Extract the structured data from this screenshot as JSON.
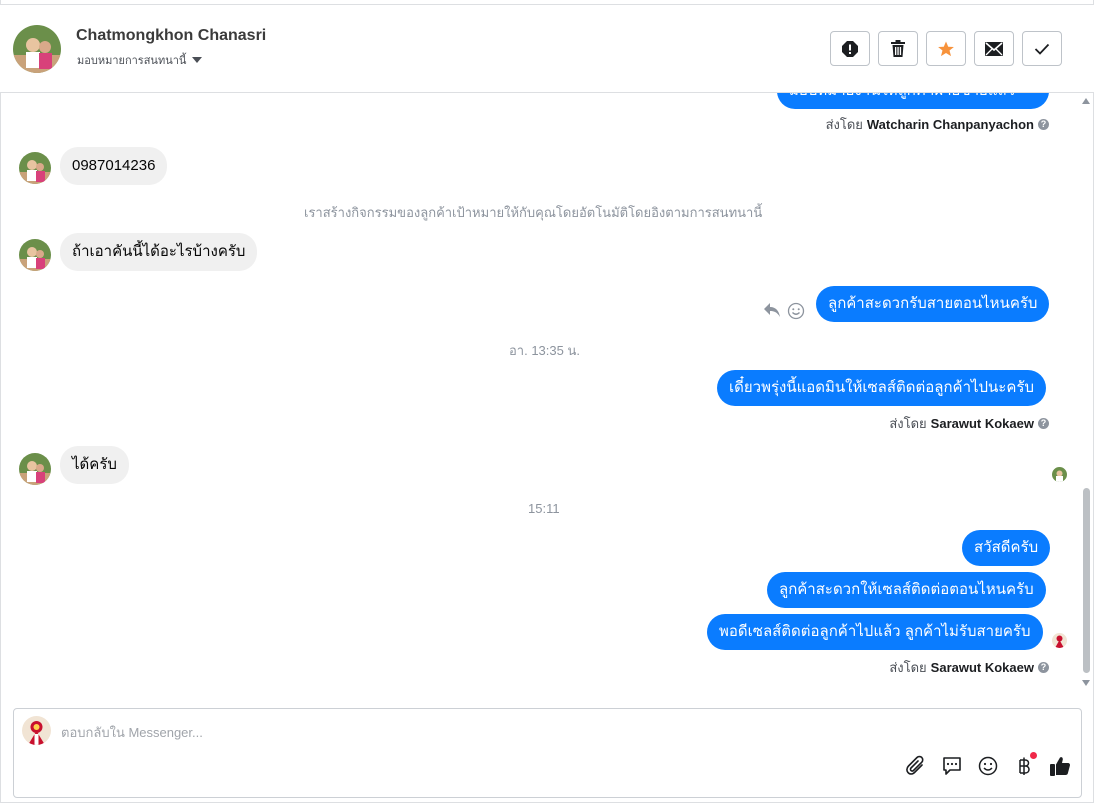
{
  "header": {
    "name": "Chatmongkhon Chanasri",
    "assign_label": "มอบหมายการสนทนานี้",
    "buttons": [
      "mark-spam",
      "delete",
      "star",
      "mark-unread",
      "mark-done"
    ]
  },
  "thread": {
    "messages": [
      {
        "type": "outgoing_partial",
        "text": "มอบหมายงานให้ลูกค้าฝ่ายขายแล้ว"
      },
      {
        "type": "sent_by",
        "prefix": "ส่งโดย",
        "agent": "Watcharin Chanpanyachon"
      },
      {
        "type": "incoming",
        "text": "0987014236"
      },
      {
        "type": "system",
        "text": "เราสร้างกิจกรรมของลูกค้าเป้าหมายให้กับคุณโดยอัตโนมัติโดยอิงตามการสนทนานี้"
      },
      {
        "type": "incoming",
        "text": "ถ้าเอาคันนี้ได้อะไรบ้างครับ"
      },
      {
        "type": "outgoing",
        "text": "ลูกค้าสะดวกรับสายตอนไหนครับ"
      },
      {
        "type": "timestamp",
        "text": "อา. 13:35 น."
      },
      {
        "type": "outgoing",
        "text": "เดี๋ยวพรุ่งนี้แอดมินให้เซลส์ติดต่อลูกค้าไปนะครับ"
      },
      {
        "type": "sent_by",
        "prefix": "ส่งโดย",
        "agent": "Sarawut Kokaew"
      },
      {
        "type": "incoming",
        "text": "ได้ครับ"
      },
      {
        "type": "timestamp",
        "text": "15:11"
      },
      {
        "type": "outgoing",
        "text": "สวัสดีครับ"
      },
      {
        "type": "outgoing",
        "text": "ลูกค้าสะดวกให้เซลส์ติดต่อตอนไหนครับ"
      },
      {
        "type": "outgoing",
        "text": "พอดีเซลส์ติดต่อลูกค้าไปแล้ว ลูกค้าไม่รับสายครับ"
      },
      {
        "type": "sent_by",
        "prefix": "ส่งโดย",
        "agent": "Sarawut Kokaew"
      }
    ]
  },
  "composer": {
    "placeholder": "ตอบกลับใน Messenger...",
    "tools": [
      "paperclip-icon",
      "saved-reply-icon",
      "emoji-icon",
      "baht-payment-icon",
      "like-icon"
    ]
  },
  "colors": {
    "outgoing_bubble": "#0a7cff",
    "incoming_bubble": "#f0f0f0",
    "star": "#f7923b",
    "notification_dot": "#f02849"
  }
}
